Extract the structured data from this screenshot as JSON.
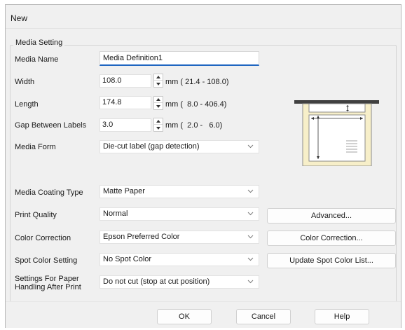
{
  "window": {
    "title": "New"
  },
  "group": {
    "title": "Media Setting"
  },
  "media_name": {
    "label": "Media Name",
    "value": "Media Definition1"
  },
  "width": {
    "label": "Width",
    "value": "108.0",
    "range": "mm ( 21.4 - 108.0)"
  },
  "length": {
    "label": "Length",
    "value": "174.8",
    "range": "mm (  8.0 - 406.4)"
  },
  "gap": {
    "label": "Gap Between Labels",
    "value": "3.0",
    "range": "mm (  2.0 -   6.0)"
  },
  "media_form": {
    "label": "Media Form",
    "value": "Die-cut label (gap detection)"
  },
  "media_coating": {
    "label": "Media Coating Type",
    "value": "Matte Paper"
  },
  "print_quality": {
    "label": "Print Quality",
    "value": "Normal",
    "button": "Advanced..."
  },
  "color_correction": {
    "label": "Color Correction",
    "value": "Epson Preferred Color",
    "button": "Color Correction..."
  },
  "spot_color": {
    "label": "Spot Color Setting",
    "value": "No Spot Color",
    "button": "Update Spot Color List..."
  },
  "paper_handling": {
    "label": "Settings For Paper Handling After Print",
    "value": "Do not cut (stop at cut position)"
  },
  "footer": {
    "ok": "OK",
    "cancel": "Cancel",
    "help": "Help"
  },
  "icons": {
    "spin_up": "spin-up-icon",
    "spin_down": "spin-down-icon",
    "dropdown": "chevron-down-icon",
    "media": "media-layout-illustration"
  },
  "colors": {
    "accent": "#1f66c1",
    "dialog_bg": "#f0f0f0"
  }
}
